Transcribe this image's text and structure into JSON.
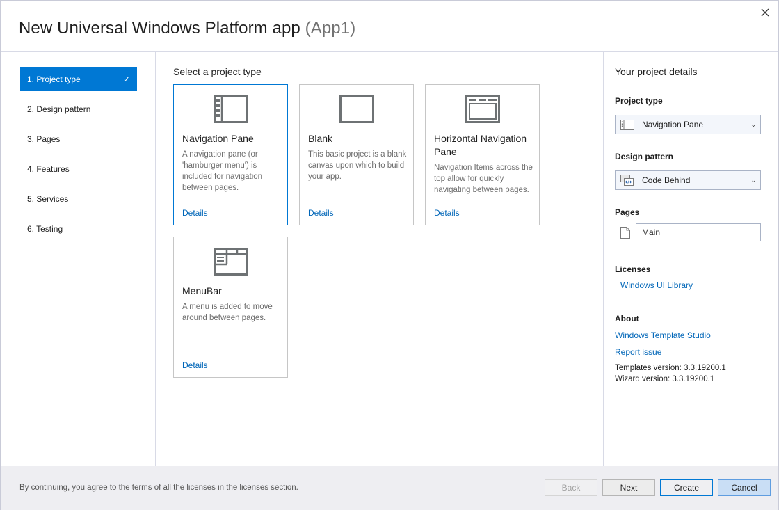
{
  "window": {
    "title": "New Universal Windows Platform app",
    "project_name": "(App1)",
    "close_icon": "close-icon"
  },
  "steps": [
    {
      "label": "1. Project type",
      "active": true,
      "completed": true
    },
    {
      "label": "2. Design pattern",
      "active": false
    },
    {
      "label": "3. Pages",
      "active": false
    },
    {
      "label": "4. Features",
      "active": false
    },
    {
      "label": "5. Services",
      "active": false
    },
    {
      "label": "6. Testing",
      "active": false
    }
  ],
  "main": {
    "title": "Select a project type",
    "cards": [
      {
        "name": "Navigation Pane",
        "description": "A navigation pane (or 'hamburger menu') is included for navigation between pages.",
        "details": "Details",
        "icon": "navigation-pane-icon",
        "selected": true
      },
      {
        "name": "Blank",
        "description": "This basic project is a blank canvas upon which to build your app.",
        "details": "Details",
        "icon": "blank-icon",
        "selected": false
      },
      {
        "name": "Horizontal Navigation Pane",
        "description": "Navigation Items across the top allow for quickly navigating between pages.",
        "details": "Details",
        "icon": "horizontal-navigation-icon",
        "selected": false
      },
      {
        "name": "MenuBar",
        "description": "A menu is added to move around between pages.",
        "details": "Details",
        "icon": "menubar-icon",
        "selected": false
      }
    ]
  },
  "details": {
    "title": "Your project details",
    "project_type_label": "Project type",
    "project_type_value": "Navigation Pane",
    "design_pattern_label": "Design pattern",
    "design_pattern_value": "Code Behind",
    "pages_label": "Pages",
    "pages": [
      "Main"
    ],
    "licenses_label": "Licenses",
    "licenses": [
      "Windows UI Library"
    ],
    "about_label": "About",
    "about_links": [
      "Windows Template Studio",
      "Report issue"
    ],
    "templates_version": "Templates version: 3.3.19200.1",
    "wizard_version": "Wizard version: 3.3.19200.1"
  },
  "footer": {
    "notice": "By continuing, you agree to the terms of all the licenses in the licenses section.",
    "back": "Back",
    "next": "Next",
    "create": "Create",
    "cancel": "Cancel"
  },
  "colors": {
    "accent": "#0078d4",
    "link": "#0066b8",
    "footer_bg": "#eeeef2"
  }
}
